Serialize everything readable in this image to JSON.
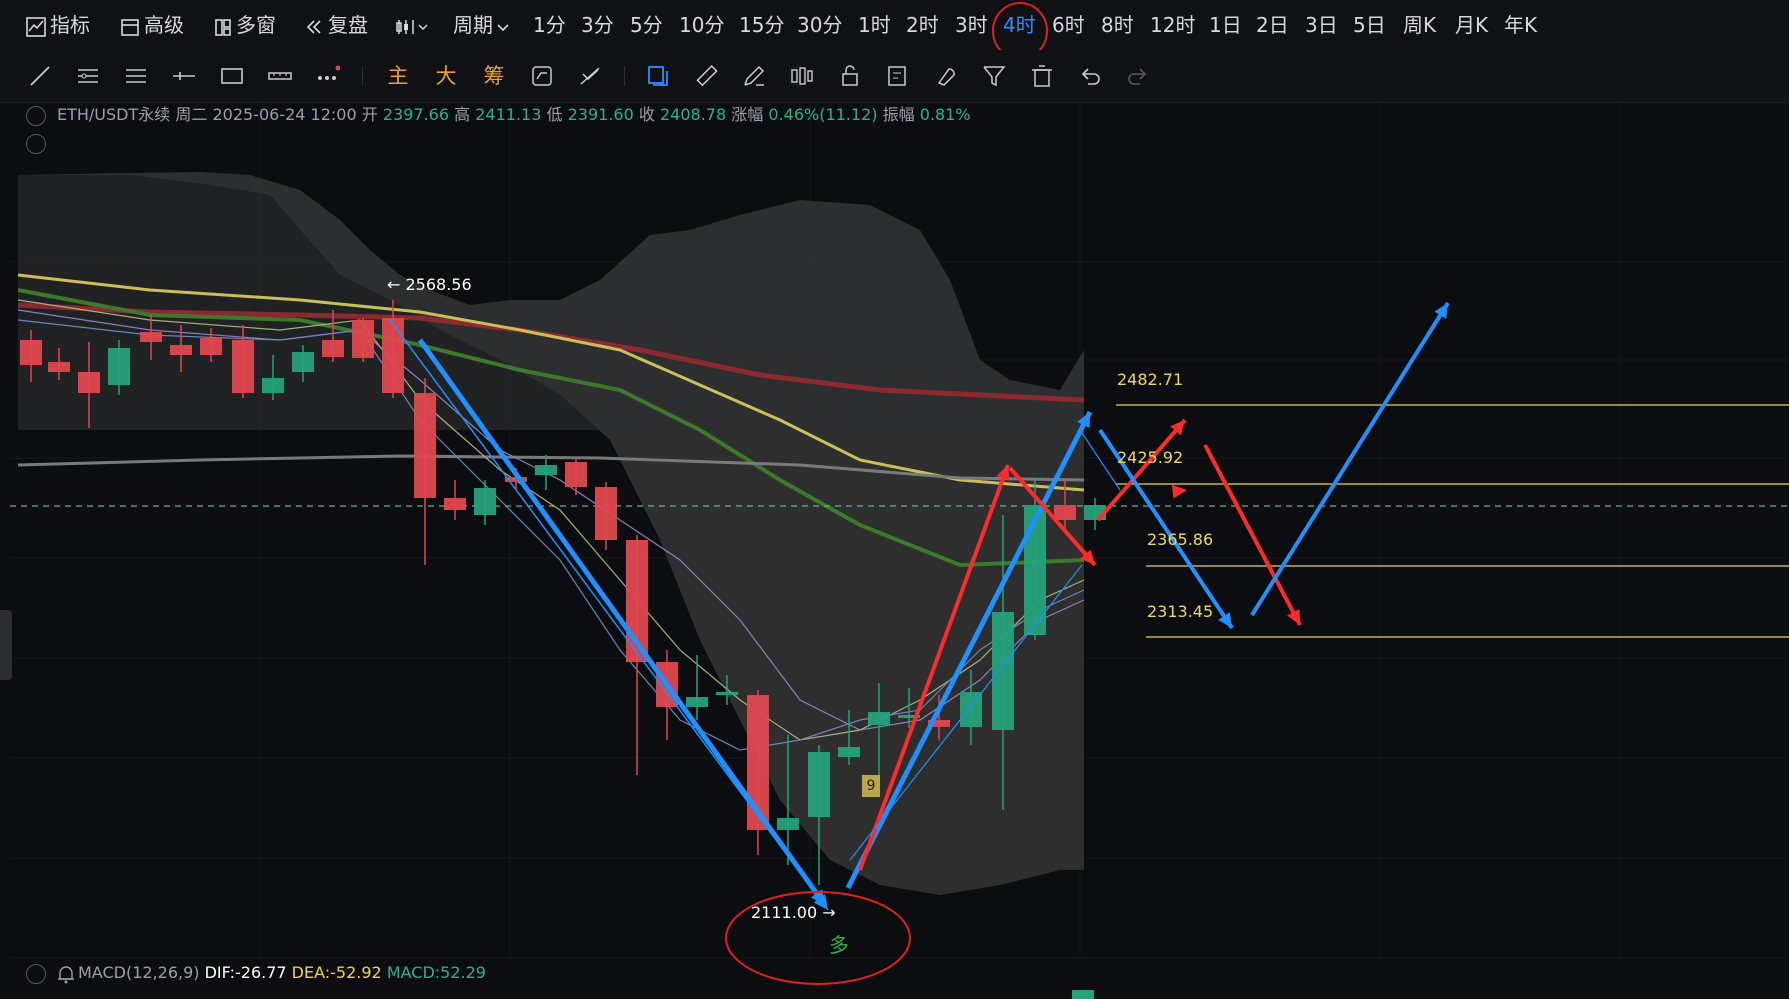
{
  "topbar": {
    "indicators": "指标",
    "advanced": "高级",
    "multi_window": "多窗",
    "replay": "复盘",
    "period": "周期",
    "intervals": [
      "1分",
      "3分",
      "5分",
      "10分",
      "15分",
      "30分",
      "1时",
      "2时",
      "3时",
      "4时",
      "6时",
      "8时",
      "12时",
      "1日",
      "2日",
      "3日",
      "5日",
      "周K",
      "月K",
      "年K"
    ],
    "active_interval": "4时"
  },
  "toolbar": {
    "main": "主",
    "big": "大",
    "chips": "筹"
  },
  "info": {
    "symbol": "ETH/USDT永续",
    "weekday": "周二",
    "datetime": "2025-06-24 12:00",
    "open_label": "开",
    "open": "2397.66",
    "high_label": "高",
    "high": "2411.13",
    "low_label": "低",
    "low": "2391.60",
    "close_label": "收",
    "close": "2408.78",
    "change_label": "涨幅",
    "change": "0.46%(11.12)",
    "amp_label": "振幅",
    "amp": "0.81%"
  },
  "annotations": {
    "high_marker": "← 2568.56",
    "low_marker": "2111.00 →",
    "long_signal": "多",
    "td_count": "9",
    "levels": [
      "2482.71",
      "2425.92",
      "2365.86",
      "2313.45"
    ]
  },
  "macd": {
    "name": "MACD(12,26,9)",
    "dif": "DIF:-26.77",
    "dea": "DEA:-52.92",
    "macd": "MACD:52.29"
  },
  "colors": {
    "up": "#26a17b",
    "down": "#e0474f",
    "accent": "#2f8cff",
    "level": "#e6d55a",
    "bollinger": "#3a3a3a"
  }
}
